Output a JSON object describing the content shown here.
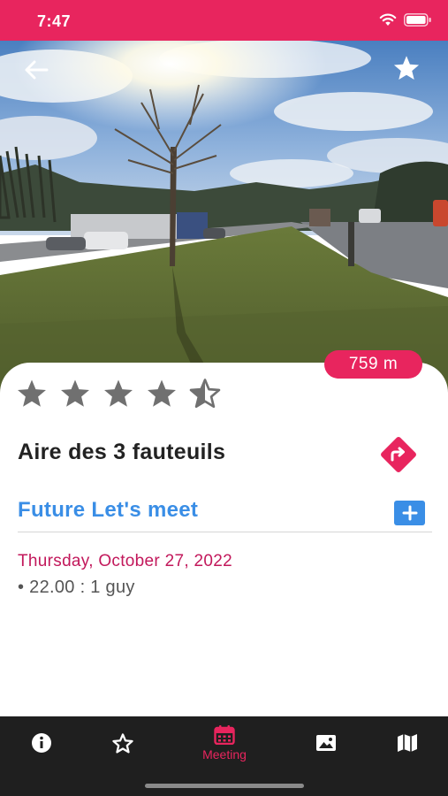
{
  "status_bar": {
    "time": "7:47"
  },
  "hero": {
    "image_description_icon": "roadside-rest-area-photo"
  },
  "header": {
    "back_icon": "arrow-left-icon",
    "favorite_icon": "star-icon"
  },
  "place": {
    "distance": "759 m",
    "rating": 4.5,
    "rating_max": 5,
    "name": "Aire des 3 fauteuils"
  },
  "meetings": {
    "section_title": "Future Let's meet",
    "date": "Thursday, October 27, 2022",
    "items": [
      "• 22.00 : 1 guy"
    ]
  },
  "tab_bar": {
    "active_tab": "Meeting",
    "tabs": [
      {
        "icon": "info-icon",
        "label": ""
      },
      {
        "icon": "star-outline-icon",
        "label": ""
      },
      {
        "icon": "calendar-icon",
        "label": "Meeting"
      },
      {
        "icon": "image-icon",
        "label": ""
      },
      {
        "icon": "map-icon",
        "label": ""
      }
    ]
  },
  "colors": {
    "accent": "#e8255e",
    "link": "#3a8ee6",
    "date": "#c2185b",
    "tab_bg": "#1f1f1f"
  }
}
